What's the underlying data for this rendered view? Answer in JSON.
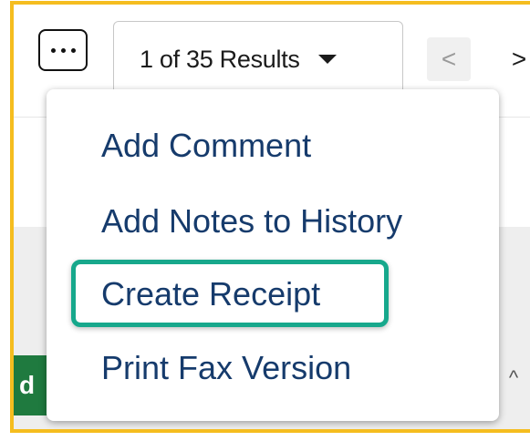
{
  "toolbar": {
    "more_label": "More actions",
    "results_label": "1 of 35 Results",
    "prev_symbol": "<",
    "next_symbol": ">"
  },
  "menu": {
    "items": [
      {
        "label": "Add Comment"
      },
      {
        "label": "Add Notes to History"
      },
      {
        "label": "Create Receipt",
        "highlighted": true
      },
      {
        "label": "Print Fax Version"
      }
    ]
  },
  "background": {
    "chip_text": "d",
    "caret_symbol": "^"
  },
  "colors": {
    "frame_border": "#f5bd1f",
    "menu_text": "#163b6c",
    "highlight": "#17a88c",
    "green_chip": "#1f7a3f"
  }
}
